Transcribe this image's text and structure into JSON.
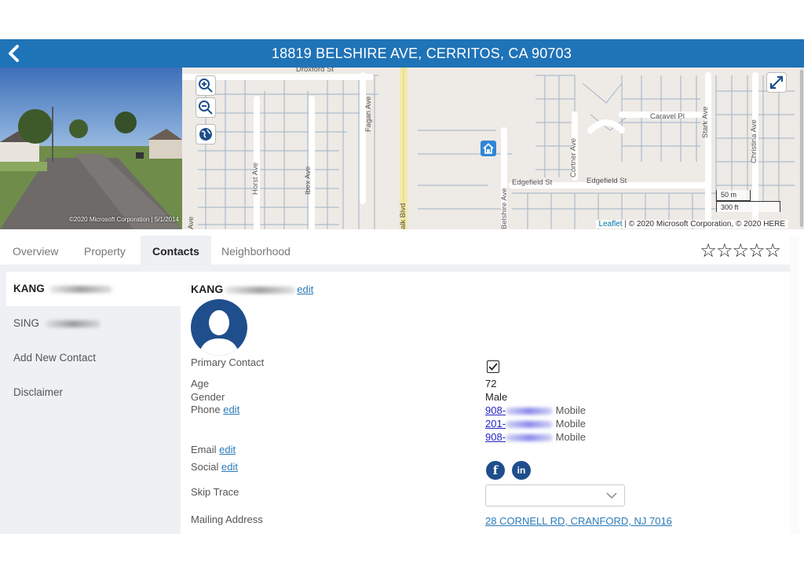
{
  "header": {
    "title": "18819 BELSHIRE AVE, CERRITOS, CA 90703",
    "back_icon": "chevron-left-icon"
  },
  "street_view": {
    "credit": "©2020 Microsoft Corporation | 5/1/2014"
  },
  "map": {
    "street_labels": {
      "droxford": "Droxford St",
      "caravel": "Caravel Pl",
      "edgefield_1": "Edgefield St",
      "edgefield_2": "Edgefield St",
      "horst": "Horst Ave",
      "ibex": "Ibex Ave",
      "fagan": "Fagan Ave",
      "walk_blvd": "alk Blvd",
      "belshire": "Belshire Ave",
      "cortner": "Cortner Ave",
      "stark": "Stark Ave",
      "christina": "Christina Ave",
      "edge_ave": "Ave"
    },
    "scale_metric": "50 m",
    "scale_imperial": "300 ft",
    "attribution_link": "Leaflet",
    "attribution_text": " | © 2020 Microsoft Corporation, © 2020 HERE",
    "controls": [
      "zoom-in-icon",
      "zoom-out-icon",
      "globe-icon",
      "fullscreen-icon"
    ]
  },
  "tabs": [
    {
      "label": "Overview",
      "active": false
    },
    {
      "label": "Property",
      "active": false
    },
    {
      "label": "Contacts",
      "active": true
    },
    {
      "label": "Neighborhood",
      "active": false
    }
  ],
  "rating": {
    "stars": 5,
    "filled": 0,
    "empty_star": "☆"
  },
  "sidebar": {
    "items": [
      {
        "label": "KANG",
        "active": true
      },
      {
        "label": "SING",
        "active": false
      },
      {
        "label": "Add New Contact",
        "active": false
      },
      {
        "label": "Disclaimer",
        "active": false
      }
    ]
  },
  "contact": {
    "name": "KANG",
    "edit_label": "edit",
    "fields": {
      "primary_label": "Primary Contact",
      "primary_checked": "✓",
      "age_label": "Age",
      "age_value": "72",
      "gender_label": "Gender",
      "gender_value": "Male",
      "phone_label": "Phone",
      "phone_edit": "edit",
      "phones": [
        {
          "prefix": "908-",
          "type": "Mobile"
        },
        {
          "prefix": "201-",
          "type": "Mobile"
        },
        {
          "prefix": "908-",
          "type": "Mobile"
        }
      ],
      "email_label": "Email",
      "email_edit": "edit",
      "social_label": "Social",
      "social_edit": "edit",
      "social_icons": [
        {
          "icon": "facebook-icon",
          "glyph": "f"
        },
        {
          "icon": "linkedin-icon",
          "glyph": "in"
        }
      ],
      "skip_trace_label": "Skip Trace",
      "skip_trace_value": "",
      "mailing_label": "Mailing Address",
      "mailing_value": "28 CORNELL RD, CRANFORD, NJ 7016"
    }
  },
  "colors": {
    "header_bg": "#1f73b7",
    "link": "#2a7ab8",
    "phone_link": "#2323c8",
    "avatar": "#1f4e8c"
  }
}
